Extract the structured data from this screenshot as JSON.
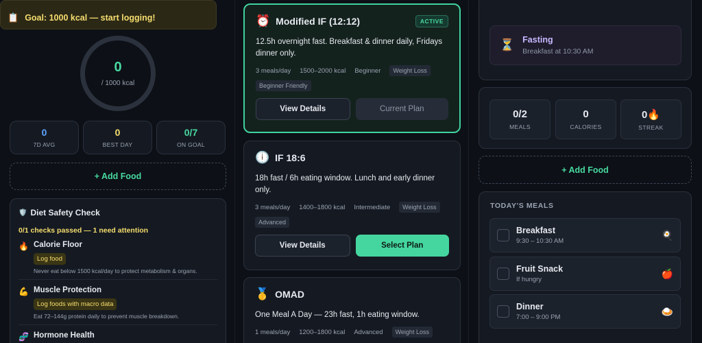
{
  "left": {
    "goal_icon": "clipboard-icon",
    "goal_text": "Goal: 1000 kcal — start logging!",
    "ring": {
      "value": "0",
      "label": "/ 1000 kcal"
    },
    "stats": [
      {
        "value": "0",
        "label": "7D AVG",
        "color": "#5ea2ff"
      },
      {
        "value": "0",
        "label": "BEST DAY",
        "color": "#f5dd6e"
      },
      {
        "value": "0/7",
        "label": "ON GOAL",
        "color": "#47d9a0"
      }
    ],
    "add_food": "+ Add Food",
    "safety": {
      "title": "Diet Safety Check",
      "summary": "0/1 checks passed — 1 need attention",
      "checks": [
        {
          "icon": "🔥",
          "title": "Calorie Floor",
          "badge": "Log food",
          "desc": "Never eat below 1500 kcal/day to protect metabolism & organs."
        },
        {
          "icon": "💪",
          "title": "Muscle Protection",
          "badge": "Log foods with macro data",
          "desc": "Eat 72–144g protein daily to prevent muscle breakdown."
        },
        {
          "icon": "🧬",
          "title": "Hormone Health",
          "badge": "",
          "desc": ""
        }
      ]
    }
  },
  "plans": [
    {
      "icon": "⏰",
      "title": "Modified IF (12:12)",
      "badge": "ACTIVE",
      "desc": "12.5h overnight fast. Breakfast & dinner daily, Fridays dinner only.",
      "meals": "3 meals/day",
      "kcal": "1500–2000 kcal",
      "level": "Beginner",
      "tags": [
        "Weight Loss",
        "Beginner Friendly"
      ],
      "btn1": "View Details",
      "btn2": "Current Plan"
    },
    {
      "icon": "🕕",
      "title": "IF 18:6",
      "badge": "",
      "desc": "18h fast / 6h eating window. Lunch and early dinner only.",
      "meals": "3 meals/day",
      "kcal": "1400–1800 kcal",
      "level": "Intermediate",
      "tags": [
        "Weight Loss",
        "Advanced"
      ],
      "btn1": "View Details",
      "btn2": "Select Plan"
    },
    {
      "icon": "🥇",
      "title": "OMAD",
      "badge": "",
      "desc": "One Meal A Day — 23h fast, 1h eating window.",
      "meals": "1 meals/day",
      "kcal": "1200–1800 kcal",
      "level": "Advanced",
      "tags": [
        "Weight Loss"
      ],
      "btn1": "",
      "btn2": ""
    }
  ],
  "right": {
    "fasting": {
      "icon": "⏳",
      "title": "Fasting",
      "subtitle": "Breakfast at 10:30 AM"
    },
    "mini": [
      {
        "value": "0/2",
        "label": "MEALS"
      },
      {
        "value": "0",
        "label": "CALORIES"
      },
      {
        "value": "0🔥",
        "label": "STREAK"
      }
    ],
    "add_food": "+ Add Food",
    "meals_title": "TODAY'S MEALS",
    "meals": [
      {
        "name": "Breakfast",
        "time": "9:30 – 10:30 AM",
        "icon": "🍳"
      },
      {
        "name": "Fruit Snack",
        "time": "If hungry",
        "icon": "🍎"
      },
      {
        "name": "Dinner",
        "time": "7:00 – 9:00 PM",
        "icon": "🍛"
      }
    ]
  }
}
